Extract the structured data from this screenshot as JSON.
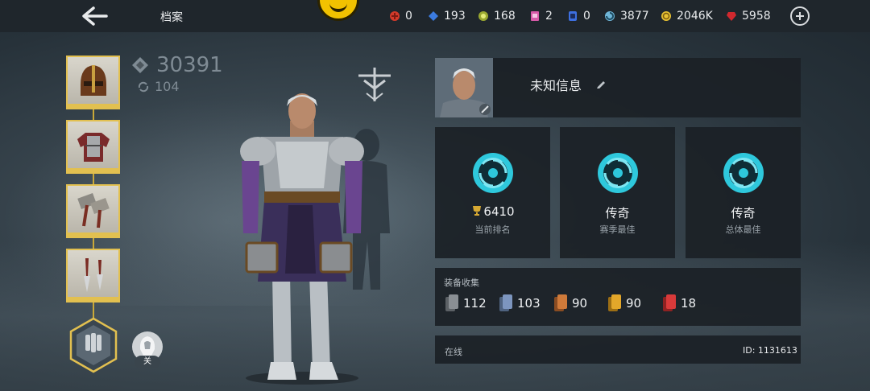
{
  "header": {
    "title": "档案",
    "resources": [
      {
        "name": "red-token",
        "icon": "red-token-icon",
        "value": "0",
        "color": "#d23a2a"
      },
      {
        "name": "blue-gem",
        "icon": "blue-gem-icon",
        "value": "193",
        "color": "#3b7be0"
      },
      {
        "name": "green-token",
        "icon": "green-token-icon",
        "value": "168",
        "color": "#b6c43a"
      },
      {
        "name": "ticket",
        "icon": "pink-ticket-icon",
        "value": "2",
        "color": "#d65aa8"
      },
      {
        "name": "blue-card",
        "icon": "blue-card-icon",
        "value": "0",
        "color": "#3d6fe0"
      },
      {
        "name": "energy",
        "icon": "swirl-icon",
        "value": "3877",
        "color": "#6fb6d8"
      },
      {
        "name": "coins",
        "icon": "gold-coin-icon",
        "value": "2046K",
        "color": "#e6c032"
      },
      {
        "name": "rubies",
        "icon": "ruby-icon",
        "value": "5958",
        "color": "#d0282e"
      }
    ]
  },
  "character": {
    "power": "30391",
    "level": "104",
    "toggle_label": "关"
  },
  "equipment": [
    {
      "slot": "helmet",
      "icon": "helmet-icon"
    },
    {
      "slot": "armor",
      "icon": "armor-icon"
    },
    {
      "slot": "weapon",
      "icon": "hammers-icon"
    },
    {
      "slot": "ranged",
      "icon": "daggers-icon"
    }
  ],
  "profile": {
    "name": "未知信息",
    "ranks": [
      {
        "value": "6410",
        "label": "当前排名",
        "has_trophy": true
      },
      {
        "value": "传奇",
        "label": "赛季最佳",
        "has_trophy": false
      },
      {
        "value": "传奇",
        "label": "总体最佳",
        "has_trophy": false
      }
    ],
    "collection": {
      "title": "装备收集",
      "items": [
        {
          "tier": "common",
          "value": "112",
          "color": "#8a8f94"
        },
        {
          "tier": "uncommon",
          "value": "103",
          "color": "#7d96bf"
        },
        {
          "tier": "rare",
          "value": "90",
          "color": "#cf7a3a"
        },
        {
          "tier": "epic",
          "value": "90",
          "color": "#e3a72a"
        },
        {
          "tier": "legendary",
          "value": "18",
          "color": "#d83a3a"
        }
      ]
    },
    "status": "在线",
    "id": "ID: 1131613"
  },
  "colors": {
    "accent_gold": "#e2c050",
    "rank_cyan": "#2ec8dc"
  }
}
